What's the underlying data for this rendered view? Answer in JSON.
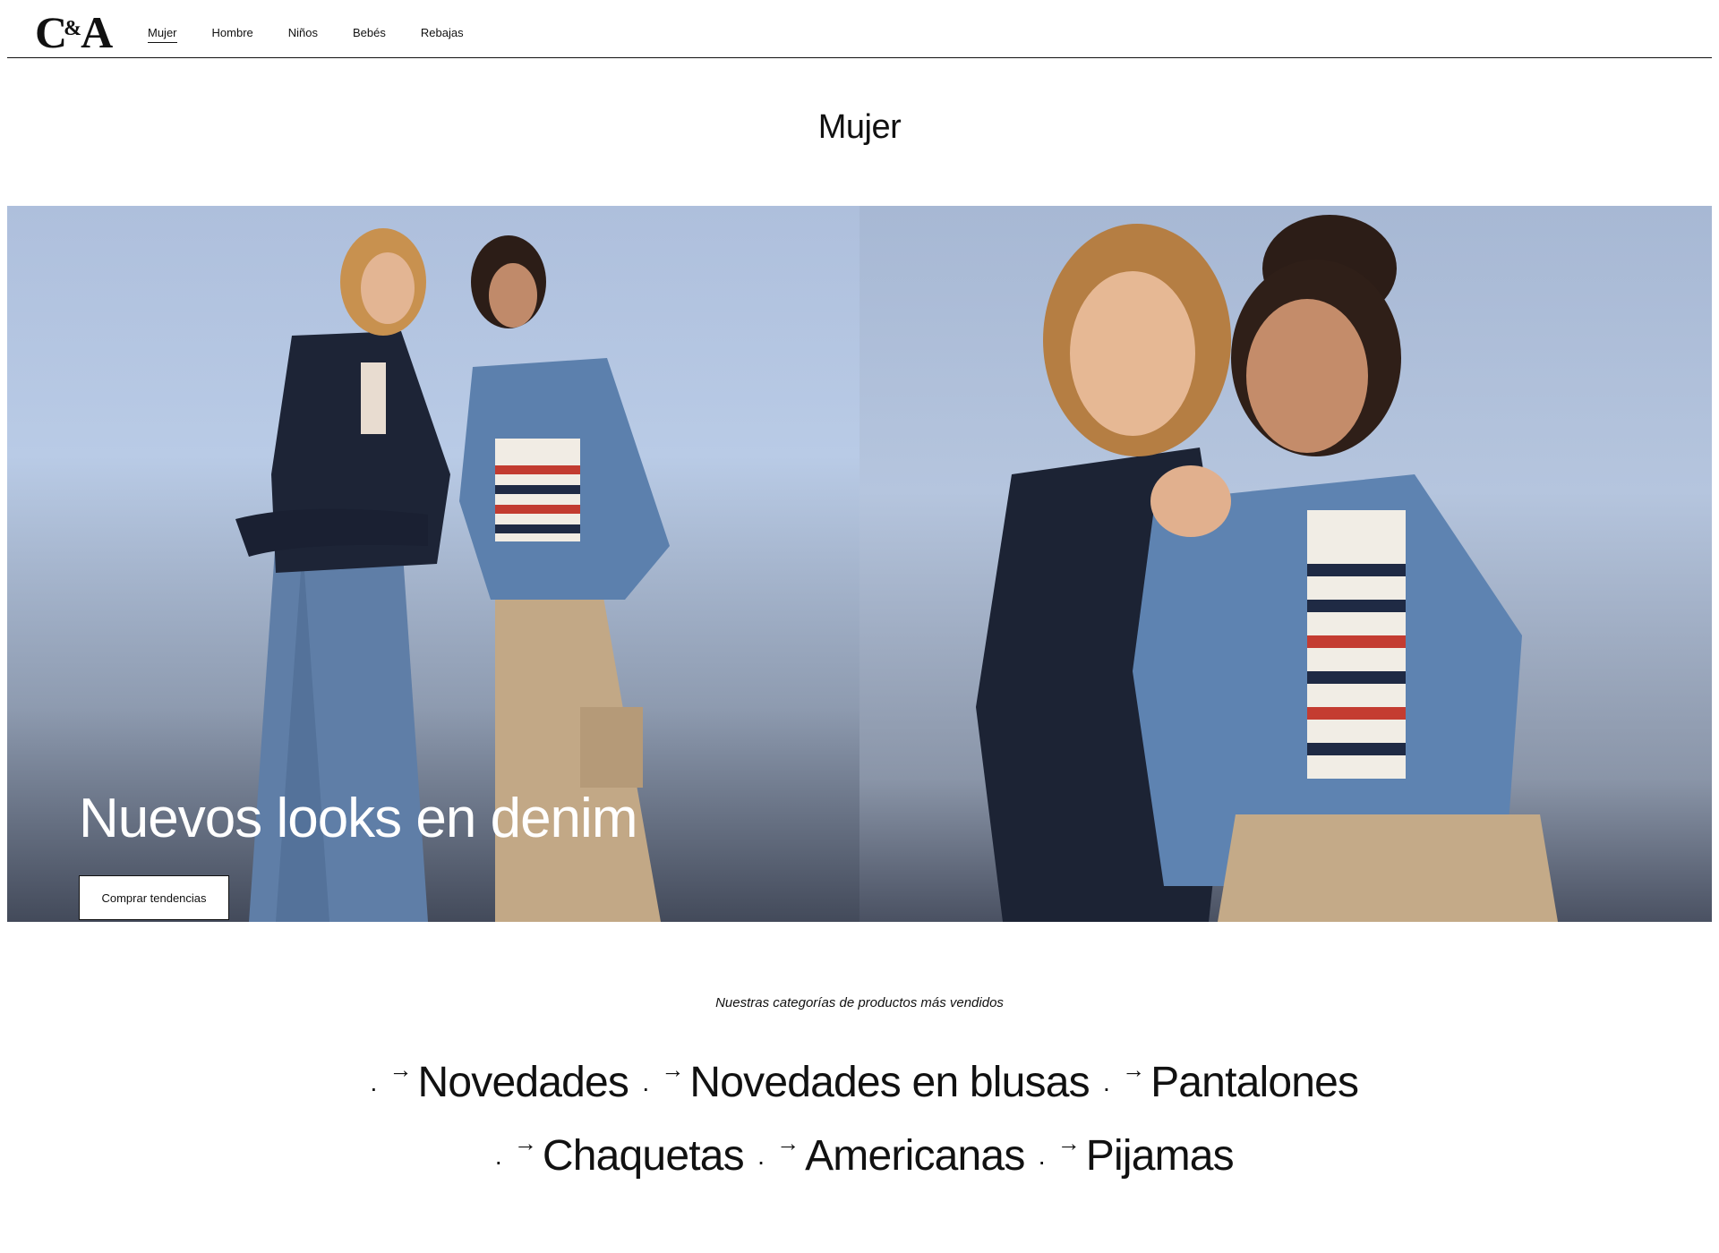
{
  "brand": {
    "logo_left": "C",
    "logo_amp": "&",
    "logo_right": "A"
  },
  "nav": {
    "items": [
      {
        "label": "Mujer",
        "active": true
      },
      {
        "label": "Hombre",
        "active": false
      },
      {
        "label": "Niños",
        "active": false
      },
      {
        "label": "Bebés",
        "active": false
      },
      {
        "label": "Rebajas",
        "active": false
      }
    ]
  },
  "page": {
    "title": "Mujer"
  },
  "hero": {
    "headline": "Nuevos looks en denim",
    "cta_label": "Comprar tendencias"
  },
  "categories": {
    "subtitle": "Nuestras categorías de productos más vendidos",
    "separator": "·",
    "arrow": "→",
    "items": [
      {
        "label": "Novedades"
      },
      {
        "label": "Novedades en blusas"
      },
      {
        "label": "Pantalones"
      },
      {
        "label": "Chaquetas"
      },
      {
        "label": "Americanas"
      },
      {
        "label": "Pijamas"
      }
    ]
  },
  "colors": {
    "text": "#111111",
    "background": "#ffffff",
    "hero_sky": "#b7c9e3",
    "button_bg": "#ffffff"
  }
}
